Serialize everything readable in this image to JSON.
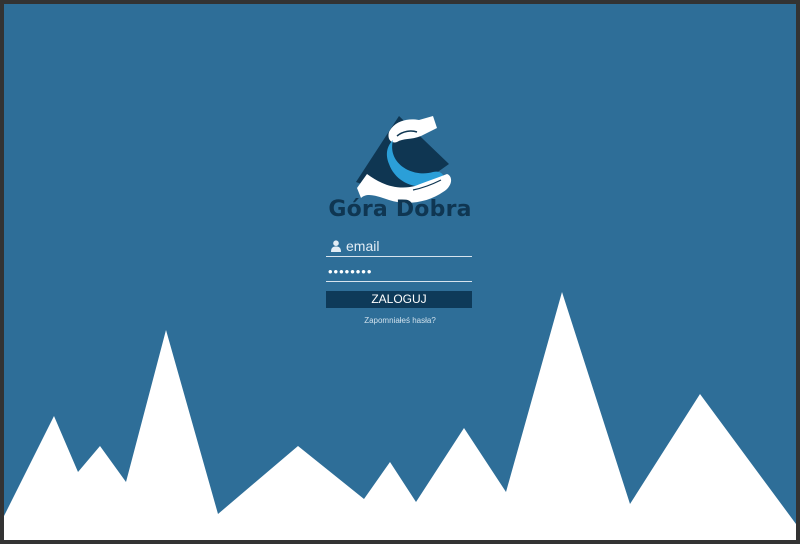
{
  "brand": {
    "title": "Góra Dobra",
    "logo": "hands-mountain-river-logo"
  },
  "login_form": {
    "email_placeholder": "email",
    "email_value": "",
    "password_value": "••••••••",
    "submit_label": "ZALOGUJ",
    "forgot_password_label": "Zapomniałeś hasła?"
  },
  "icons": {
    "email_field_icon": "user-icon"
  },
  "colors": {
    "background": "#2e6e98",
    "mountains": "#ffffff",
    "button": "#0e3a59",
    "brand_text": "#0f3652",
    "frame_border": "#333333"
  }
}
